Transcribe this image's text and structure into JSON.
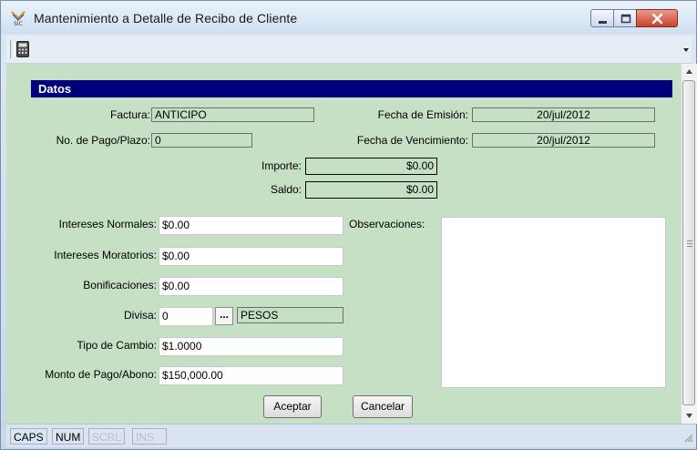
{
  "window": {
    "title": "Mantenimiento a Detalle de Recibo de Cliente",
    "icon": "app-logo-icon"
  },
  "toolbar": {
    "icon": "calculator-icon"
  },
  "section": {
    "header": "Datos"
  },
  "fields": {
    "factura": {
      "label": "Factura:",
      "value": "ANTICIPO"
    },
    "fecha_emision": {
      "label": "Fecha de Emisión:",
      "value": "20/jul/2012"
    },
    "no_pago": {
      "label": "No. de Pago/Plazo:",
      "value": "0"
    },
    "fecha_vencimiento": {
      "label": "Fecha de Vencimiento:",
      "value": "20/jul/2012"
    },
    "importe": {
      "label": "Importe:",
      "value": "$0.00"
    },
    "saldo": {
      "label": "Saldo:",
      "value": "$0.00"
    },
    "intereses_normales": {
      "label": "Intereses Normales:",
      "value": "$0.00"
    },
    "intereses_moratorios": {
      "label": "Intereses Moratorios:",
      "value": "$0.00"
    },
    "bonificaciones": {
      "label": "Bonificaciones:",
      "value": "$0.00"
    },
    "divisa": {
      "label": "Divisa:",
      "value": "0",
      "button": "...",
      "name": "PESOS"
    },
    "tipo_cambio": {
      "label": "Tipo de Cambio:",
      "value": "$1.0000"
    },
    "monto_pago": {
      "label": "Monto de Pago/Abono:",
      "value": "$150,000.00"
    },
    "observaciones": {
      "label": "Observaciones:",
      "value": ""
    }
  },
  "buttons": {
    "aceptar": "Aceptar",
    "cancelar": "Cancelar"
  },
  "status": {
    "caps": "CAPS",
    "num": "NUM",
    "scrl": "SCRL",
    "ins": "INS"
  },
  "colors": {
    "client_bg": "#c5e0c5",
    "header_bg": "#00007b",
    "close_red": "#c8442a"
  }
}
